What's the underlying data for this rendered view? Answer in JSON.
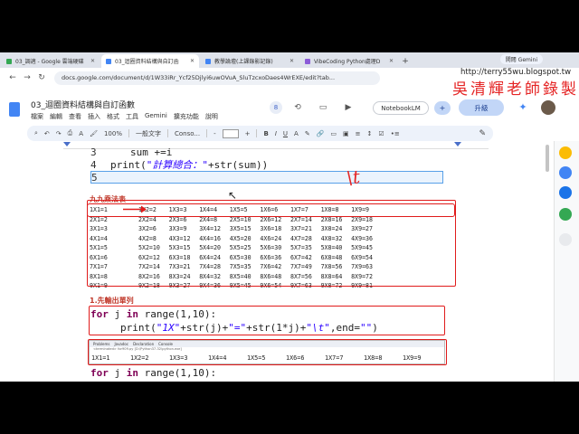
{
  "browser": {
    "tabs": [
      {
        "label": "03_調適 - Google 雲端硬碟",
        "color": "#34a853",
        "active": false
      },
      {
        "label": "03_迴圈資料結構與自訂函",
        "color": "#4285f4",
        "active": true
      },
      {
        "label": "教學論壇(上課錄影記錄)",
        "color": "#4285f4",
        "active": false
      },
      {
        "label": "VibeCoding Python處理D",
        "color": "#8c5cd8",
        "active": false
      }
    ],
    "new_tab": "+",
    "gemini": "開閱 Gemini",
    "url": "docs.google.com/document/d/1W33iRr_Ycf25Djlyi6uwOVuA_SluTzcxoDaes4WrEXE/edit?tab...",
    "blog_url": "http://terry55wu.blogspot.tw"
  },
  "watermark": "吳清輝老師錄製",
  "doc": {
    "title": "03_迴圈資料結構與自訂函數",
    "menu": [
      "檔案",
      "編輯",
      "查看",
      "插入",
      "格式",
      "工具",
      "Gemini",
      "擴充功能",
      "說明"
    ],
    "badge": "8",
    "notebook_label": "NotebookLM",
    "upgrade_label": "升級"
  },
  "toolbar": {
    "zoom": "100%",
    "style": "一般文字",
    "font": "Conso...",
    "minus": "-",
    "plus": "+"
  },
  "code_top": {
    "line3_num": "3",
    "line3": "sum +=i",
    "line4_num": "4",
    "line4_fn": "print(",
    "line4_str": "\"計算總合：\"",
    "line4_rest": "+str(sum))",
    "line5_num": "5"
  },
  "handwriting": "\\t",
  "section1_title": "九九乘法表",
  "multiplication_table": [
    [
      "1X1=1",
      "1X2=2",
      "1X3=3",
      "1X4=4",
      "1X5=5",
      "1X6=6",
      "1X7=7",
      "1X8=8",
      "1X9=9"
    ],
    [
      "2X1=2",
      "2X2=4",
      "2X3=6",
      "2X4=8",
      "2X5=10",
      "2X6=12",
      "2X7=14",
      "2X8=16",
      "2X9=18"
    ],
    [
      "3X1=3",
      "3X2=6",
      "3X3=9",
      "3X4=12",
      "3X5=15",
      "3X6=18",
      "3X7=21",
      "3X8=24",
      "3X9=27"
    ],
    [
      "4X1=4",
      "4X2=8",
      "4X3=12",
      "4X4=16",
      "4X5=20",
      "4X6=24",
      "4X7=28",
      "4X8=32",
      "4X9=36"
    ],
    [
      "5X1=5",
      "5X2=10",
      "5X3=15",
      "5X4=20",
      "5X5=25",
      "5X6=30",
      "5X7=35",
      "5X8=40",
      "5X9=45"
    ],
    [
      "6X1=6",
      "6X2=12",
      "6X3=18",
      "6X4=24",
      "6X5=30",
      "6X6=36",
      "6X7=42",
      "6X8=48",
      "6X9=54"
    ],
    [
      "7X1=7",
      "7X2=14",
      "7X3=21",
      "7X4=28",
      "7X5=35",
      "7X6=42",
      "7X7=49",
      "7X8=56",
      "7X9=63"
    ],
    [
      "8X1=8",
      "8X2=16",
      "8X3=24",
      "8X4=32",
      "8X5=40",
      "8X6=48",
      "8X7=56",
      "8X8=64",
      "8X9=72"
    ],
    [
      "9X1=9",
      "9X2=18",
      "9X3=27",
      "9X4=36",
      "9X5=45",
      "9X6=54",
      "9X7=63",
      "9X8=72",
      "9X9=81"
    ]
  ],
  "section2_title": "1.先輸出單列",
  "code_for": {
    "line1_kw": "for",
    "line1_mid": " j ",
    "line1_in": "in",
    "line1_rest": " range(1,10):",
    "line2_fn": "print(",
    "line2_s1": "\"1X\"",
    "line2_m1": "+str(j)+",
    "line2_s2": "\"=\"",
    "line2_m2": "+str(1*j)+",
    "line2_s3": "\"\\t\"",
    "line2_m3": ",end=",
    "line2_s4": "\"\"",
    "line2_end": ")"
  },
  "console": {
    "tabs": [
      "Problems",
      "Javadoc",
      "Declaration",
      "Console"
    ],
    "subtitle": "<terminated> for909.py [D:\\Python37-32\\python.exe]",
    "output": [
      "1X1=1",
      "1X2=2",
      "1X3=3",
      "1X4=4",
      "1X5=5",
      "1X6=6",
      "1X7=7",
      "1X8=8",
      "1X9=9"
    ]
  },
  "code_bottom": {
    "kw": "for",
    "mid": " j ",
    "in": "in",
    "rest": " range(1,10):"
  },
  "colors": {
    "red_annotation": "#e01b1b",
    "keyword": "#7f0055",
    "string": "#2a00ff"
  }
}
